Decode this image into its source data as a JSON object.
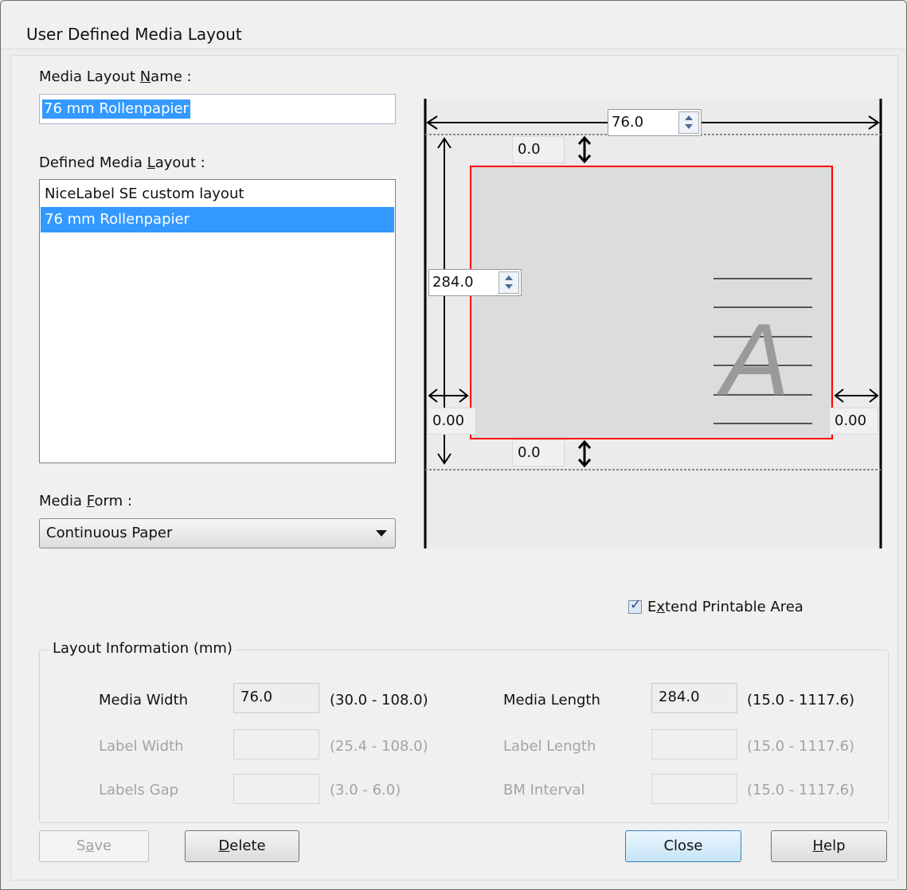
{
  "window": {
    "title": "User Defined Media Layout"
  },
  "name_section": {
    "label_pre": "Media Layout ",
    "label_key": "N",
    "label_post": "ame :",
    "value": "76 mm Rollenpapier"
  },
  "defined_section": {
    "label_pre": "Defined Media ",
    "label_key": "L",
    "label_post": "ayout :",
    "items": [
      {
        "label": "NiceLabel SE custom layout",
        "selected": false
      },
      {
        "label": "76 mm Rollenpapier",
        "selected": true
      }
    ]
  },
  "form_section": {
    "label_pre": "Media ",
    "label_key": "F",
    "label_post": "orm :",
    "selected": "Continuous Paper"
  },
  "preview": {
    "width": "76.0",
    "length": "284.0",
    "top_margin": "0.0",
    "bottom_margin": "0.0",
    "left_margin": "0.00",
    "right_margin": "0.00",
    "sample_glyph": "A",
    "colors": {
      "label_border": "#ff0000",
      "dimension_lines": "#000000"
    }
  },
  "extend": {
    "label_pre": "E",
    "label_key": "x",
    "label_post": "tend Printable Area",
    "checked": true
  },
  "layout_info": {
    "title": "Layout Information (mm)",
    "media_width": {
      "label": "Media Width",
      "value": "76.0",
      "range": "(30.0 - 108.0)"
    },
    "label_width": {
      "label": "Label Width",
      "value": "",
      "range": "(25.4 - 108.0)"
    },
    "labels_gap": {
      "label": "Labels Gap",
      "value": "",
      "range": "(3.0 - 6.0)"
    },
    "media_length": {
      "label": "Media Length",
      "value": "284.0",
      "range": "(15.0 - 1117.6)"
    },
    "label_length": {
      "label": "Label Length",
      "value": "",
      "range": "(15.0 - 1117.6)"
    },
    "bm_interval": {
      "label": "BM Interval",
      "value": "",
      "range": "(15.0 - 1117.6)"
    }
  },
  "buttons": {
    "save": {
      "pre": "S",
      "key": "a",
      "post": "ve"
    },
    "delete": {
      "pre": "",
      "key": "D",
      "post": "elete"
    },
    "close": {
      "label": "Close"
    },
    "help": {
      "pre": "",
      "key": "H",
      "post": "elp"
    }
  }
}
